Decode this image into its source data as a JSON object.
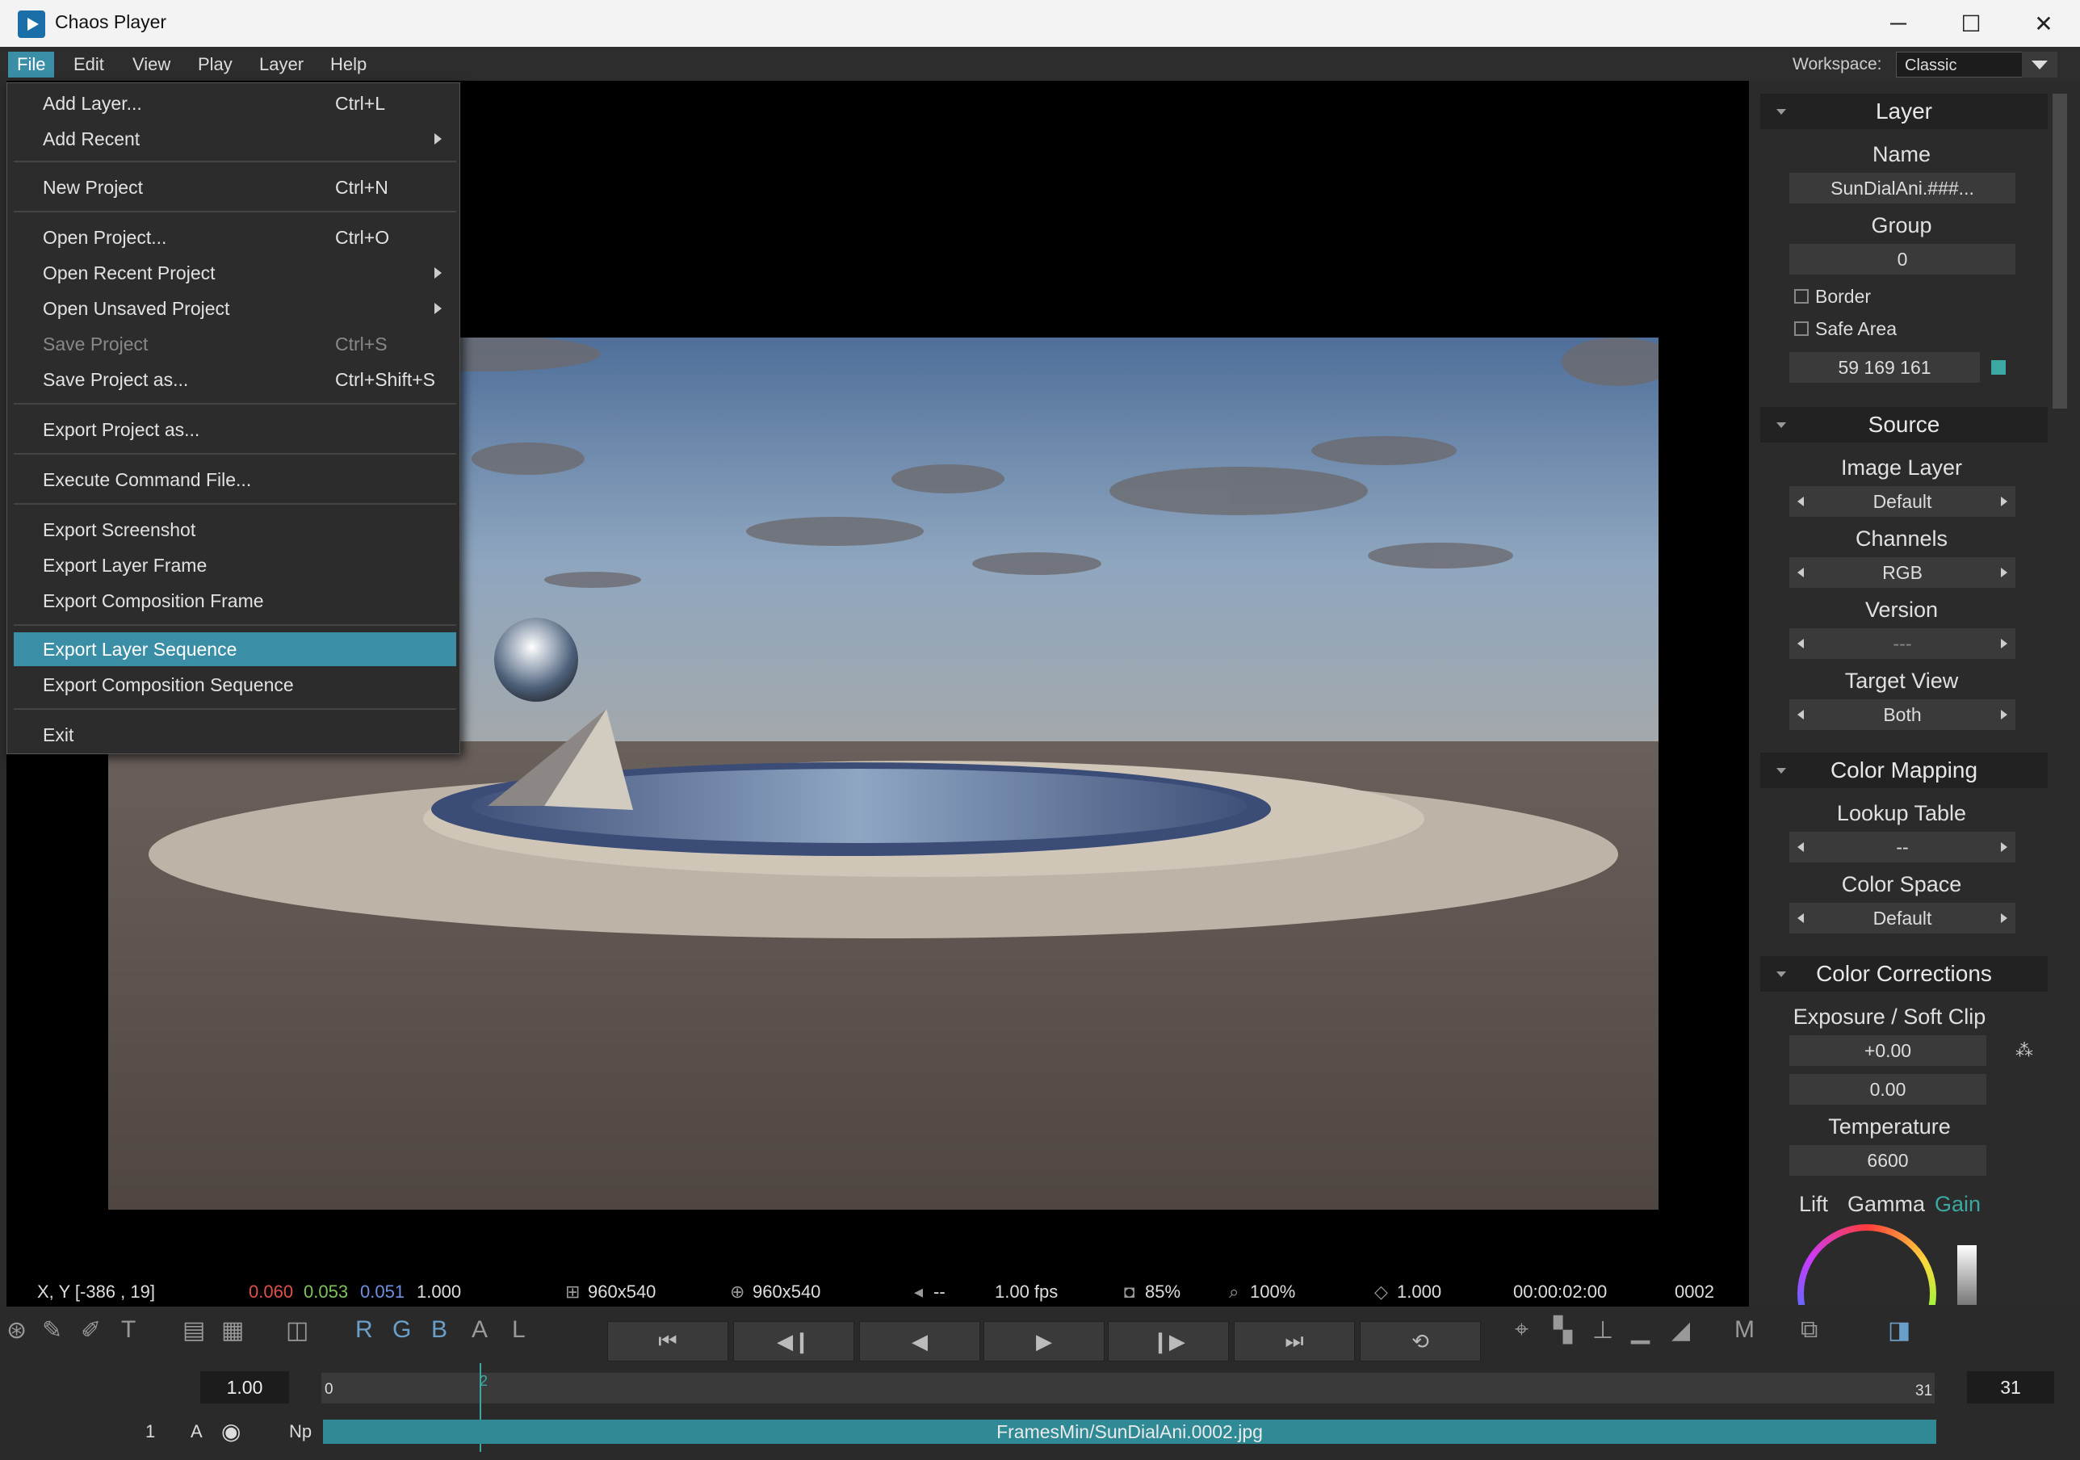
{
  "window": {
    "title": "Chaos Player",
    "minimize": "─",
    "maximize": "☐",
    "close": "✕"
  },
  "menubar": {
    "items": [
      "File",
      "Edit",
      "View",
      "Play",
      "Layer",
      "Help"
    ]
  },
  "workspace": {
    "label": "Workspace:",
    "value": "Classic"
  },
  "file_menu": {
    "items": [
      {
        "label": "Add Layer...",
        "shortcut": "Ctrl+L"
      },
      {
        "label": "Add Recent",
        "submenu": true
      },
      {
        "label": "New Project",
        "shortcut": "Ctrl+N"
      },
      {
        "label": "Open Project...",
        "shortcut": "Ctrl+O"
      },
      {
        "label": "Open Recent Project",
        "submenu": true
      },
      {
        "label": "Open Unsaved Project",
        "submenu": true
      },
      {
        "label": "Save Project",
        "shortcut": "Ctrl+S",
        "disabled": true
      },
      {
        "label": "Save Project as...",
        "shortcut": "Ctrl+Shift+S"
      },
      {
        "label": "Export Project as..."
      },
      {
        "label": "Execute Command File..."
      },
      {
        "label": "Export Screenshot"
      },
      {
        "label": "Export Layer Frame"
      },
      {
        "label": "Export Composition Frame"
      },
      {
        "label": "Export Layer Sequence",
        "selected": true
      },
      {
        "label": "Export Composition Sequence"
      },
      {
        "label": "Exit"
      }
    ]
  },
  "status": {
    "xy": "X, Y [-386 , 19]",
    "r": "0.060",
    "g": "0.053",
    "b": "0.051",
    "a": "1.000",
    "res1": "960x540",
    "res2": "960x540",
    "audio": "--",
    "fps": "1.00 fps",
    "quality": "85%",
    "zoom": "100%",
    "pixel_aspect": "1.000",
    "timecode": "00:00:02:00",
    "frame": "0002",
    "colors": {
      "r": "#e0504a",
      "g": "#7fc25a",
      "b": "#6f8fe0"
    }
  },
  "toolbar": {
    "channels": [
      "R",
      "G",
      "B",
      "A",
      "L"
    ],
    "m_label": "M"
  },
  "timeline": {
    "speed": "1.00",
    "start": "0",
    "current_marker": "2",
    "end_marker": "31",
    "end_field": "31",
    "layer_num": "1",
    "layer_a": "A",
    "layer_np": "Np",
    "layer_name": "FramesMin/SunDialAni.0002.jpg"
  },
  "panel": {
    "layer": {
      "title": "Layer",
      "name_label": "Name",
      "name_value": "SunDialAni.###...",
      "group_label": "Group",
      "group_value": "0",
      "border_label": "Border",
      "safe_area_label": "Safe Area",
      "color_value": "59 169 161",
      "color_swatch": "#3ba9a1"
    },
    "source": {
      "title": "Source",
      "image_layer_label": "Image Layer",
      "image_layer_value": "Default",
      "channels_label": "Channels",
      "channels_value": "RGB",
      "version_label": "Version",
      "version_value": "---",
      "target_view_label": "Target View",
      "target_view_value": "Both"
    },
    "color_mapping": {
      "title": "Color Mapping",
      "lut_label": "Lookup Table",
      "lut_value": "--",
      "color_space_label": "Color Space",
      "color_space_value": "Default"
    },
    "color_corrections": {
      "title": "Color Corrections",
      "exposure_label": "Exposure / Soft Clip",
      "exposure_value": "+0.00",
      "softclip_value": "0.00",
      "temperature_label": "Temperature",
      "temperature_value": "6600",
      "lift_label": "Lift",
      "gamma_label": "Gamma",
      "gain_label": "Gain"
    }
  }
}
